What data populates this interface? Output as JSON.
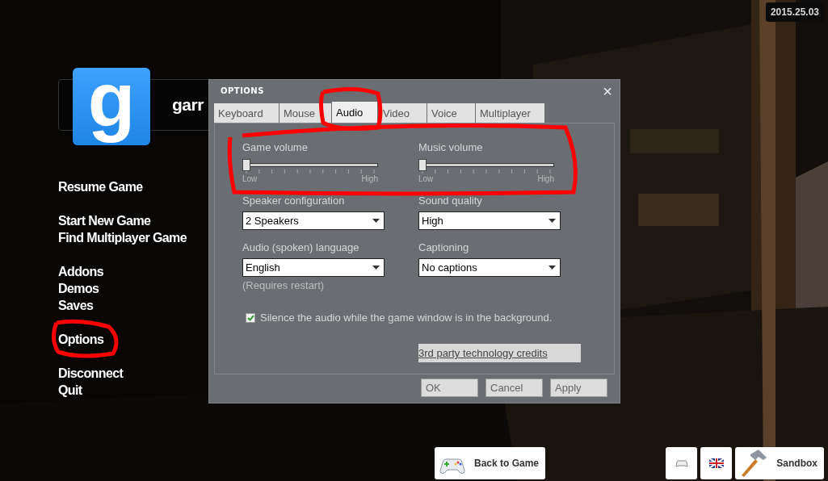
{
  "date_badge": "2015.25.03",
  "logo": {
    "letter": "g",
    "title": "garr"
  },
  "menu_groups": [
    [
      "Resume Game"
    ],
    [
      "Start New Game",
      "Find Multiplayer Game"
    ],
    [
      "Addons",
      "Demos",
      "Saves"
    ],
    [
      "Options"
    ],
    [
      "Disconnect",
      "Quit"
    ]
  ],
  "dialog": {
    "title": "OPTIONS",
    "close": "×",
    "tabs": [
      {
        "label": "Keyboard",
        "selected": false
      },
      {
        "label": "Mouse",
        "selected": false
      },
      {
        "label": "Audio",
        "selected": true
      },
      {
        "label": "Video",
        "selected": false
      },
      {
        "label": "Voice",
        "selected": false
      },
      {
        "label": "Multiplayer",
        "selected": false
      }
    ],
    "sliders": [
      {
        "label": "Game volume",
        "level": 0,
        "min_label": "Low",
        "max_label": "High"
      },
      {
        "label": "Music volume",
        "level": 0,
        "min_label": "Low",
        "max_label": "High"
      }
    ],
    "dropdowns": [
      {
        "label": "Speaker configuration",
        "value": "2 Speakers"
      },
      {
        "label": "Sound quality",
        "value": "High"
      },
      {
        "label": "Audio (spoken) language",
        "value": "English",
        "note": "(Requires restart)"
      },
      {
        "label": "Captioning",
        "value": "No captions"
      }
    ],
    "checkbox": {
      "label": "Silence the audio while the game window is in the background.",
      "checked": true
    },
    "credits_button": "3rd party technology credits",
    "buttons": [
      "OK",
      "Cancel",
      "Apply"
    ]
  },
  "back_button": "Back to Game",
  "sandbox_button": "Sandbox"
}
